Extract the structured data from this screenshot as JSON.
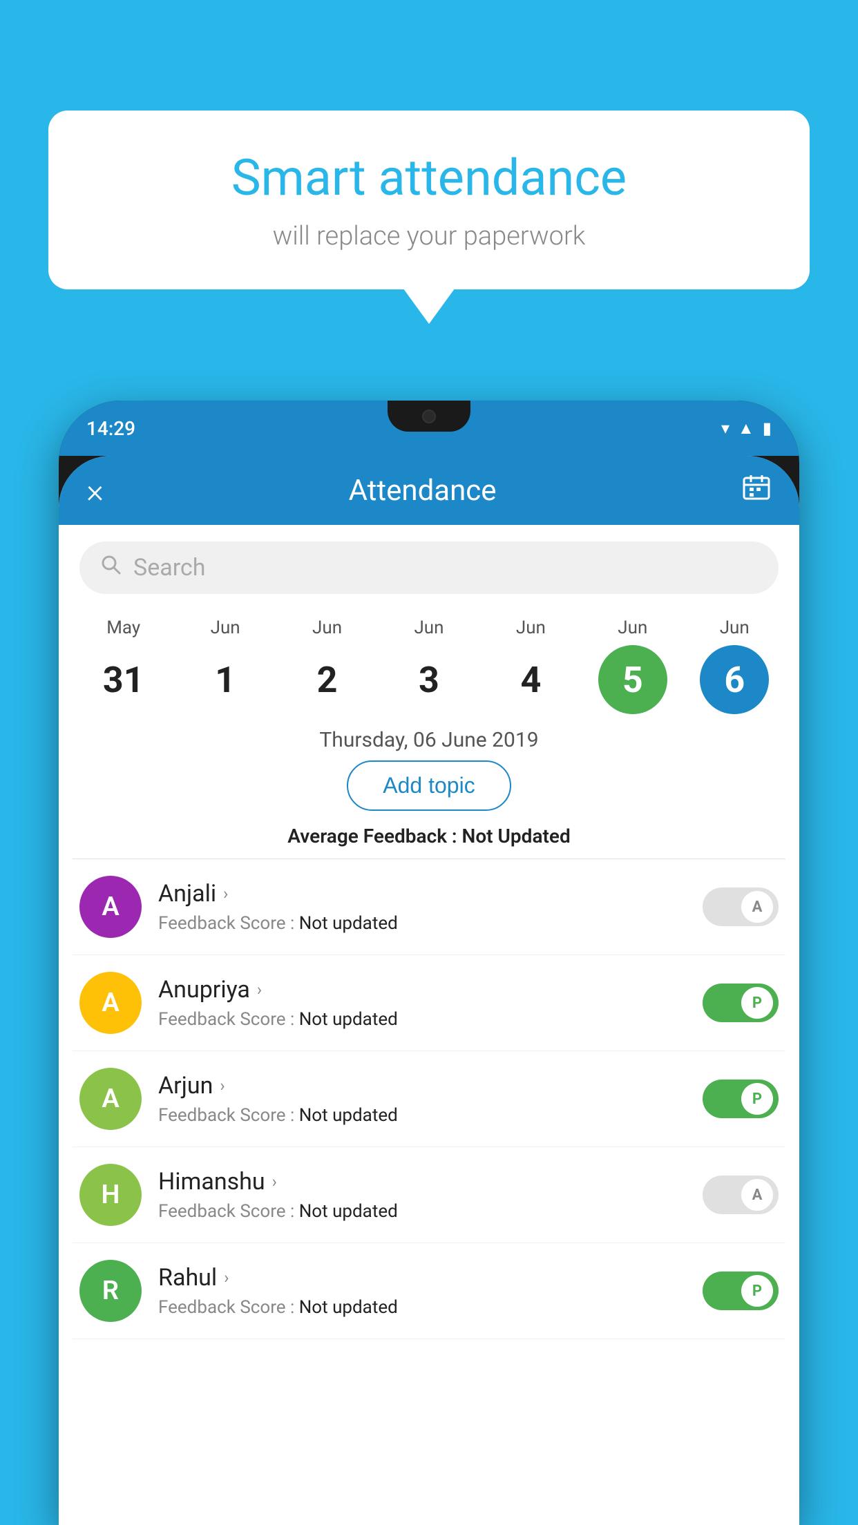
{
  "background": {
    "color": "#29B6E8"
  },
  "speech_bubble": {
    "title": "Smart attendance",
    "subtitle": "will replace your paperwork"
  },
  "phone": {
    "status_bar": {
      "time": "14:29"
    },
    "header": {
      "close_label": "×",
      "title": "Attendance",
      "calendar_icon": "📅"
    },
    "search": {
      "placeholder": "Search"
    },
    "calendar": {
      "days": [
        {
          "month": "May",
          "date": "31",
          "state": "normal"
        },
        {
          "month": "Jun",
          "date": "1",
          "state": "normal"
        },
        {
          "month": "Jun",
          "date": "2",
          "state": "normal"
        },
        {
          "month": "Jun",
          "date": "3",
          "state": "normal"
        },
        {
          "month": "Jun",
          "date": "4",
          "state": "normal"
        },
        {
          "month": "Jun",
          "date": "5",
          "state": "today"
        },
        {
          "month": "Jun",
          "date": "6",
          "state": "selected"
        }
      ]
    },
    "selected_date_label": "Thursday, 06 June 2019",
    "add_topic_label": "Add topic",
    "avg_feedback_label": "Average Feedback :",
    "avg_feedback_value": "Not Updated",
    "students": [
      {
        "name": "Anjali",
        "initial": "A",
        "avatar_color": "#9C27B0",
        "score_label": "Feedback Score :",
        "score_value": "Not updated",
        "toggle_state": "off",
        "toggle_label": "A"
      },
      {
        "name": "Anupriya",
        "initial": "A",
        "avatar_color": "#FFC107",
        "score_label": "Feedback Score :",
        "score_value": "Not updated",
        "toggle_state": "on",
        "toggle_label": "P"
      },
      {
        "name": "Arjun",
        "initial": "A",
        "avatar_color": "#8BC34A",
        "score_label": "Feedback Score :",
        "score_value": "Not updated",
        "toggle_state": "on",
        "toggle_label": "P"
      },
      {
        "name": "Himanshu",
        "initial": "H",
        "avatar_color": "#8BC34A",
        "score_label": "Feedback Score :",
        "score_value": "Not updated",
        "toggle_state": "off",
        "toggle_label": "A"
      },
      {
        "name": "Rahul",
        "initial": "R",
        "avatar_color": "#4CAF50",
        "score_label": "Feedback Score :",
        "score_value": "Not updated",
        "toggle_state": "on",
        "toggle_label": "P"
      }
    ]
  }
}
